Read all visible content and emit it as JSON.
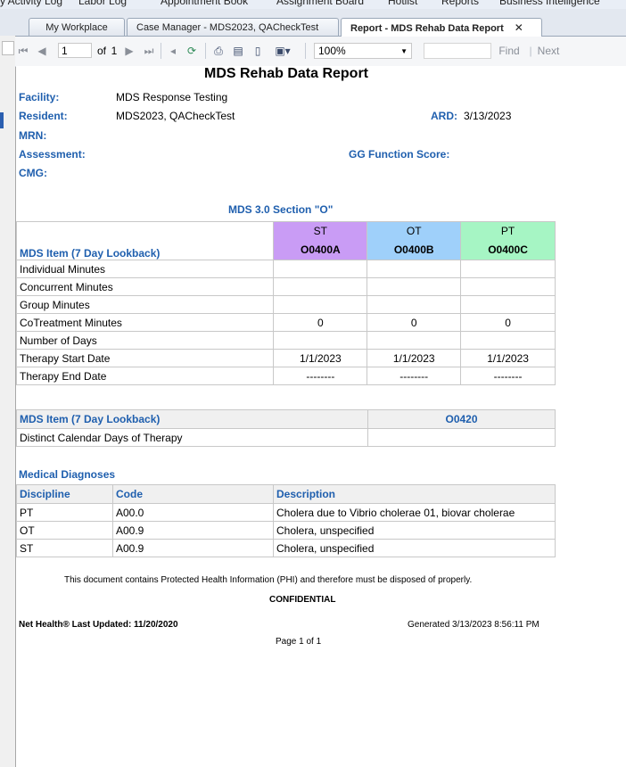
{
  "top_strip": {
    "items": [
      "y Activity Log",
      "Labor Log",
      "Appointment Book",
      "Assignment Board",
      "Hotlist",
      "Reports",
      "Business Intelligence"
    ]
  },
  "tabs": [
    {
      "label": "My Workplace"
    },
    {
      "label": "Case Manager - MDS2023, QACheckTest"
    },
    {
      "label": "Report - MDS Rehab Data Report",
      "close": "✕"
    }
  ],
  "toolbar": {
    "page_value": "1",
    "of_label": "of",
    "total_pages": "1",
    "zoom": "100%",
    "find_label": "Find",
    "separator": "|",
    "next_label": "Next"
  },
  "report": {
    "title": "MDS Rehab Data Report",
    "facility_label": "Facility:",
    "facility_value": "MDS Response Testing",
    "resident_label": "Resident:",
    "resident_value": "MDS2023, QACheckTest",
    "ard_label": "ARD:",
    "ard_value": "3/13/2023",
    "mrn_label": "MRN:",
    "assessment_label": "Assessment:",
    "gg_label": "GG Function Score:",
    "cmg_label": "CMG:",
    "section_title": "MDS 3.0 Section \"O\""
  },
  "section_o": {
    "item_header": "MDS Item (7 Day Lookback)",
    "columns": [
      {
        "discipline": "ST",
        "code": "O0400A",
        "color": "#c99cf5"
      },
      {
        "discipline": "OT",
        "code": "O0400B",
        "color": "#9fd0fa"
      },
      {
        "discipline": "PT",
        "code": "O0400C",
        "color": "#a6f5c4"
      }
    ],
    "rows": [
      {
        "label": "Individual Minutes",
        "v": [
          "",
          "",
          ""
        ]
      },
      {
        "label": "Concurrent Minutes",
        "v": [
          "",
          "",
          ""
        ]
      },
      {
        "label": "Group Minutes",
        "v": [
          "",
          "",
          ""
        ]
      },
      {
        "label": "CoTreatment Minutes",
        "v": [
          "0",
          "0",
          "0"
        ]
      },
      {
        "label": "Number of Days",
        "v": [
          "",
          "",
          ""
        ]
      },
      {
        "label": "Therapy Start Date",
        "v": [
          "1/1/2023",
          "1/1/2023",
          "1/1/2023"
        ]
      },
      {
        "label": "Therapy End Date",
        "v": [
          "--------",
          "--------",
          "--------"
        ]
      }
    ]
  },
  "o0420": {
    "item_header": "MDS Item (7 Day Lookback)",
    "code": "O0420",
    "row_label": "Distinct Calendar Days of Therapy",
    "row_value": ""
  },
  "diagnoses": {
    "title": "Medical Diagnoses",
    "headers": [
      "Discipline",
      "Code",
      "Description"
    ],
    "rows": [
      {
        "discipline": "PT",
        "code": "A00.0",
        "description": "Cholera due to Vibrio cholerae 01, biovar cholerae"
      },
      {
        "discipline": "OT",
        "code": "A00.9",
        "description": "Cholera, unspecified"
      },
      {
        "discipline": "ST",
        "code": "A00.9",
        "description": "Cholera, unspecified"
      }
    ]
  },
  "footer": {
    "phi_note": "This document contains Protected Health Information (PHI) and therefore must be disposed of properly.",
    "confidential": "CONFIDENTIAL",
    "last_updated": "Net Health® Last Updated: 11/20/2020",
    "generated": "Generated 3/13/2023 8:56:11 PM",
    "page": "Page 1 of 1"
  },
  "colors": {
    "label_blue": "#1f5fae"
  }
}
